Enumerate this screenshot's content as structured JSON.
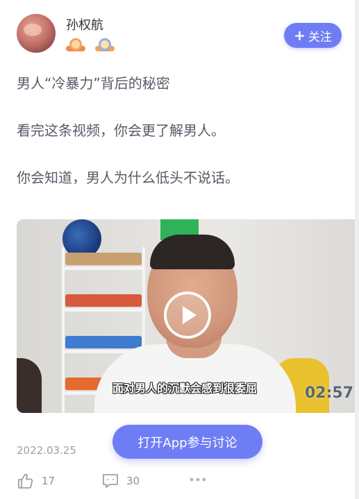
{
  "author": {
    "name": "孙权航",
    "follow_label": "关注",
    "follow_icon": "plus-icon"
  },
  "post": {
    "title_line": "男人“冷暴力”背后的秘密",
    "line2": "看完这条视频，你会更了解男人。",
    "line3": "你会知道，男人为什么低头不说话。",
    "date": "2022.03.25"
  },
  "video": {
    "subtitle": "面对男人的沉默会感到很委屈",
    "duration": "02:57"
  },
  "cta": {
    "open_app_label": "打开App参与讨论"
  },
  "actions": {
    "likes": "17",
    "comments": "30"
  },
  "colors": {
    "accent": "#6f7df5",
    "text": "#555b66",
    "muted": "#9aa0a8"
  }
}
